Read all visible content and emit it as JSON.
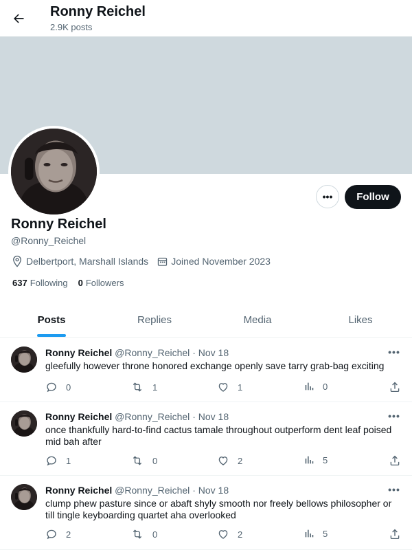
{
  "header": {
    "title": "Ronny Reichel",
    "posts_count": "2.9K posts"
  },
  "profile": {
    "name": "Ronny Reichel",
    "handle": "@Ronny_Reichel",
    "location": "Delbertport, Marshall Islands",
    "joined": "Joined November 2023",
    "following_count": "637",
    "following_label": "Following",
    "followers_count": "0",
    "followers_label": "Followers",
    "follow_button": "Follow",
    "more_button": "•••"
  },
  "colors": {
    "banner": "#cfd9de",
    "accent": "#1d9bf0",
    "button_dark": "#0f1419",
    "muted_text": "#536471"
  },
  "tabs": [
    {
      "label": "Posts",
      "active": true
    },
    {
      "label": "Replies",
      "active": false
    },
    {
      "label": "Media",
      "active": false
    },
    {
      "label": "Likes",
      "active": false
    }
  ],
  "posts": [
    {
      "name": "Ronny Reichel",
      "handle": "@Ronny_Reichel",
      "dot": "·",
      "date": "Nov 18",
      "more": "•••",
      "text": "gleefully however throne honored exchange openly save tarry grab-bag exciting",
      "replies": "0",
      "reposts": "1",
      "likes": "1",
      "views": "0"
    },
    {
      "name": "Ronny Reichel",
      "handle": "@Ronny_Reichel",
      "dot": "·",
      "date": "Nov 18",
      "more": "•••",
      "text": "once thankfully hard-to-find cactus tamale throughout outperform dent leaf poised mid bah after",
      "replies": "1",
      "reposts": "0",
      "likes": "2",
      "views": "5"
    },
    {
      "name": "Ronny Reichel",
      "handle": "@Ronny_Reichel",
      "dot": "·",
      "date": "Nov 18",
      "more": "•••",
      "text": "clump phew pasture since or abaft shyly smooth nor freely bellows philosopher or till tingle keyboarding quartet aha overlooked",
      "replies": "2",
      "reposts": "0",
      "likes": "2",
      "views": "5"
    }
  ],
  "icons": {
    "back": "arrow-left-icon",
    "location": "location-pin-icon",
    "calendar": "calendar-icon",
    "reply": "reply-icon",
    "repost": "repost-icon",
    "like": "heart-icon",
    "views": "views-chart-icon",
    "share": "share-icon"
  }
}
